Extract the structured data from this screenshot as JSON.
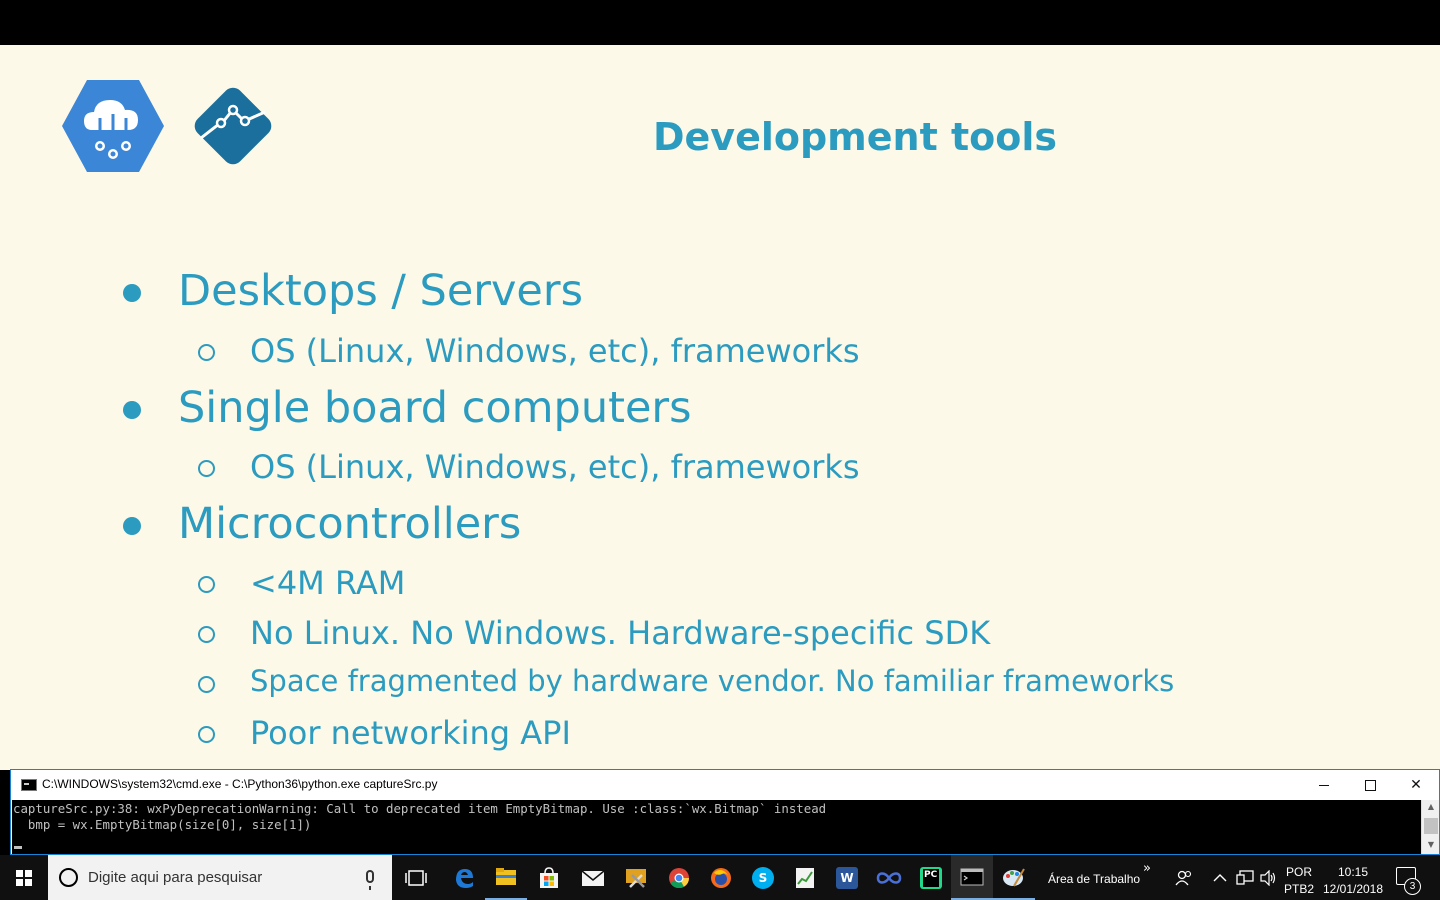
{
  "slide": {
    "title": "Development tools",
    "bullets": [
      {
        "level": 1,
        "text": "Desktops / Servers"
      },
      {
        "level": 2,
        "text": "OS (Linux, Windows, etc), frameworks"
      },
      {
        "level": 1,
        "text": "Single board computers"
      },
      {
        "level": 2,
        "text": "OS (Linux, Windows, etc), frameworks"
      },
      {
        "level": 1,
        "text": "Microcontrollers"
      },
      {
        "level": 2,
        "text": "<4M RAM"
      },
      {
        "level": 2,
        "text": "No Linux. No Windows. Hardware-specific SDK"
      },
      {
        "level": 2,
        "text": "Space fragmented by hardware vendor. No familiar frameworks"
      },
      {
        "level": 2,
        "text": "Poor networking API"
      }
    ],
    "accent_color": "#2b9bc0",
    "logo_colors": {
      "hexagon": "#3b86d6",
      "diamond": "#1a6f9c"
    }
  },
  "cmd": {
    "title": "C:\\WINDOWS\\system32\\cmd.exe - C:\\Python36\\python.exe  captureSrc.py",
    "lines": [
      "captureSrc.py:38: wxPyDeprecationWarning: Call to deprecated item EmptyBitmap. Use :class:`wx.Bitmap` instead",
      "  bmp = wx.EmptyBitmap(size[0], size[1])"
    ],
    "minimize_icon": "minimize-icon",
    "maximize_icon": "maximize-icon",
    "close_label": "✕"
  },
  "taskbar": {
    "search_placeholder": "Digite aqui para pesquisar",
    "desktop_label": "Área de Trabalho",
    "chevron": "»",
    "language": [
      "POR",
      "PTB2"
    ],
    "time": "10:15",
    "date": "12/01/2018",
    "notification_count": "3",
    "apps": [
      {
        "name": "task-view-icon"
      },
      {
        "name": "edge-icon",
        "color": "#1e79d6"
      },
      {
        "name": "file-explorer-icon",
        "color": "#f0c020"
      },
      {
        "name": "store-icon",
        "color": "#f3f3f3"
      },
      {
        "name": "mail-icon",
        "color": "#f3f3f3"
      },
      {
        "name": "tools-icon",
        "color": "#e0a020"
      },
      {
        "name": "chrome-icon",
        "color": "#db4437"
      },
      {
        "name": "firefox-icon",
        "color": "#f56a1c"
      },
      {
        "name": "skype-icon",
        "color": "#00aff0"
      },
      {
        "name": "spreadsheet-icon",
        "color": "#3a9a3a"
      },
      {
        "name": "word-icon",
        "color": "#2b579a"
      },
      {
        "name": "infinity-icon",
        "color": "#4a6fd6"
      },
      {
        "name": "pycharm-icon",
        "color": "#21d789"
      },
      {
        "name": "cmd-icon",
        "color": "#000000"
      },
      {
        "name": "paint-icon",
        "color": "#9ac8e8"
      }
    ]
  }
}
